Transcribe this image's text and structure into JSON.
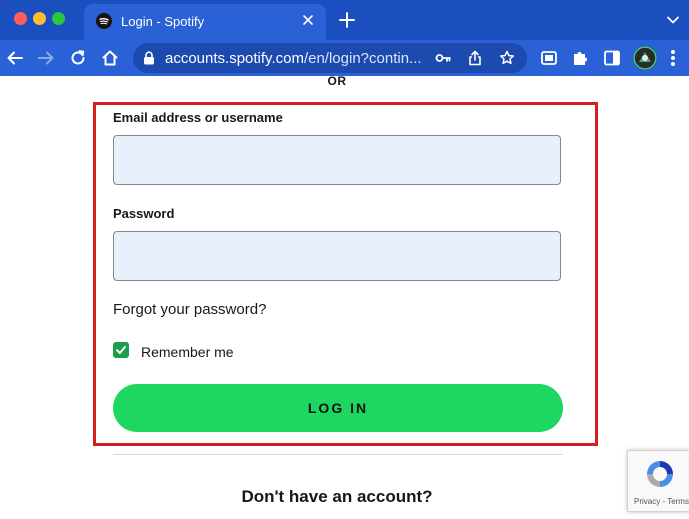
{
  "browser": {
    "tab": {
      "title": "Login - Spotify",
      "favicon": "spotify-icon",
      "close_icon": "close-icon"
    },
    "new_tab_icon": "plus-icon",
    "tab_menu_icon": "chevron-down-icon",
    "toolbar": {
      "back_icon": "arrow-left-icon",
      "forward_icon": "arrow-right-icon",
      "reload_icon": "reload-icon",
      "home_icon": "home-icon",
      "url_host": "accounts.spotify.com",
      "url_path": "/en/login?contin...",
      "lock_icon": "lock-icon",
      "password_key_icon": "key-icon",
      "share_icon": "share-icon",
      "bookmark_icon": "star-icon",
      "extension_icons": [
        "screenshot-extension-icon",
        "puzzle-icon",
        "sidebar-icon"
      ],
      "profile_icon": "avatar",
      "menu_icon": "kebab-menu-icon"
    },
    "colors": {
      "tab_strip": "#1b4fbf",
      "toolbar": "#2a61d6",
      "omnibox": "#1d4aaf"
    }
  },
  "page": {
    "or_text": "OR",
    "login_form": {
      "email_label": "Email address or username",
      "email_value": "",
      "email_placeholder": "",
      "password_label": "Password",
      "password_value": "",
      "password_placeholder": "",
      "forgot_password": "Forgot your password?",
      "remember_me_label": "Remember me",
      "remember_me_checked": true,
      "login_button": "LOG IN"
    },
    "no_account_text": "Don't have an account?",
    "recaptcha": {
      "links": "Privacy - Terms"
    },
    "colors": {
      "highlight_border": "#d41f1f",
      "button_green": "#1ed760",
      "checkbox_green": "#1e9c4a",
      "input_background": "#e8f0fe"
    }
  }
}
